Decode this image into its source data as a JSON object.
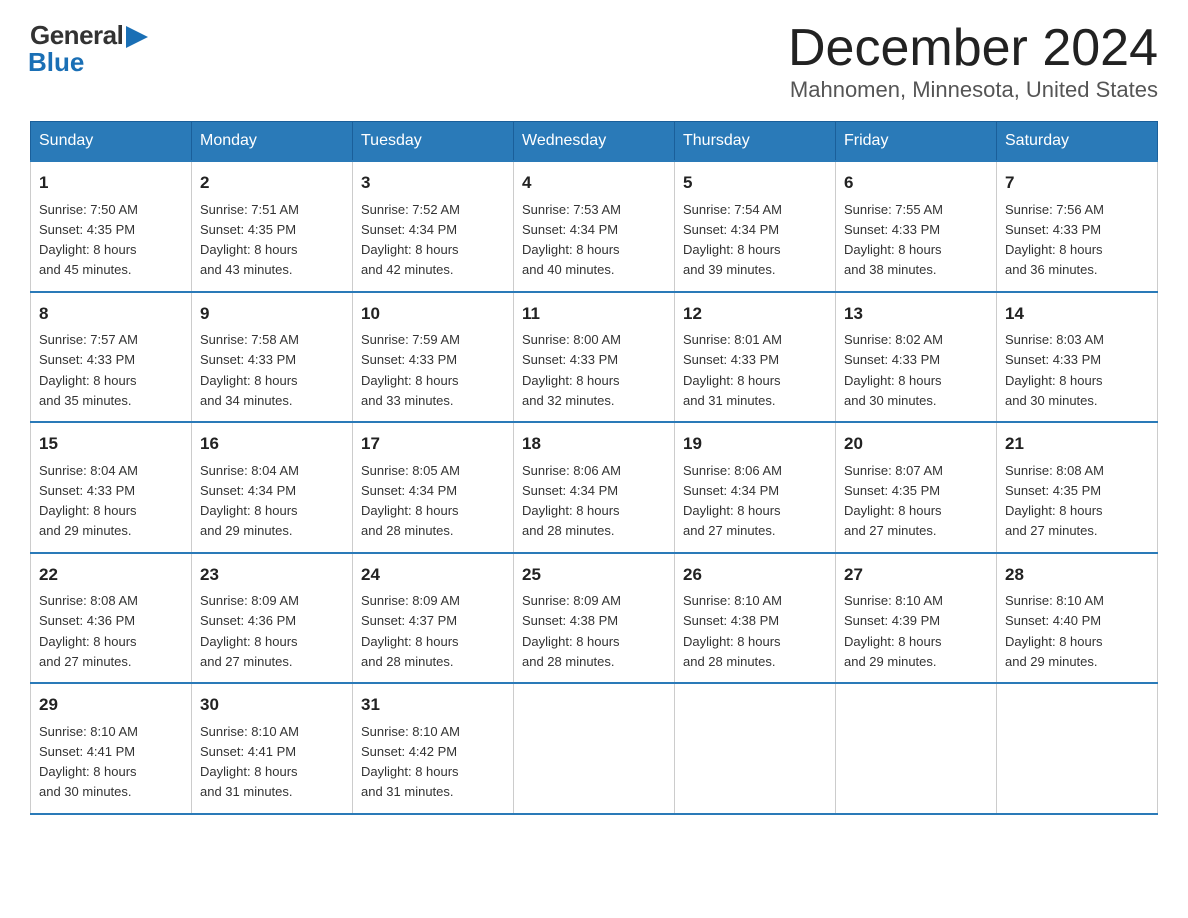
{
  "header": {
    "logo_general": "General",
    "logo_blue": "Blue",
    "month_title": "December 2024",
    "location": "Mahnomen, Minnesota, United States"
  },
  "days_of_week": [
    "Sunday",
    "Monday",
    "Tuesday",
    "Wednesday",
    "Thursday",
    "Friday",
    "Saturday"
  ],
  "weeks": [
    [
      {
        "day": "1",
        "sunrise": "7:50 AM",
        "sunset": "4:35 PM",
        "daylight": "8 hours and 45 minutes."
      },
      {
        "day": "2",
        "sunrise": "7:51 AM",
        "sunset": "4:35 PM",
        "daylight": "8 hours and 43 minutes."
      },
      {
        "day": "3",
        "sunrise": "7:52 AM",
        "sunset": "4:34 PM",
        "daylight": "8 hours and 42 minutes."
      },
      {
        "day": "4",
        "sunrise": "7:53 AM",
        "sunset": "4:34 PM",
        "daylight": "8 hours and 40 minutes."
      },
      {
        "day": "5",
        "sunrise": "7:54 AM",
        "sunset": "4:34 PM",
        "daylight": "8 hours and 39 minutes."
      },
      {
        "day": "6",
        "sunrise": "7:55 AM",
        "sunset": "4:33 PM",
        "daylight": "8 hours and 38 minutes."
      },
      {
        "day": "7",
        "sunrise": "7:56 AM",
        "sunset": "4:33 PM",
        "daylight": "8 hours and 36 minutes."
      }
    ],
    [
      {
        "day": "8",
        "sunrise": "7:57 AM",
        "sunset": "4:33 PM",
        "daylight": "8 hours and 35 minutes."
      },
      {
        "day": "9",
        "sunrise": "7:58 AM",
        "sunset": "4:33 PM",
        "daylight": "8 hours and 34 minutes."
      },
      {
        "day": "10",
        "sunrise": "7:59 AM",
        "sunset": "4:33 PM",
        "daylight": "8 hours and 33 minutes."
      },
      {
        "day": "11",
        "sunrise": "8:00 AM",
        "sunset": "4:33 PM",
        "daylight": "8 hours and 32 minutes."
      },
      {
        "day": "12",
        "sunrise": "8:01 AM",
        "sunset": "4:33 PM",
        "daylight": "8 hours and 31 minutes."
      },
      {
        "day": "13",
        "sunrise": "8:02 AM",
        "sunset": "4:33 PM",
        "daylight": "8 hours and 30 minutes."
      },
      {
        "day": "14",
        "sunrise": "8:03 AM",
        "sunset": "4:33 PM",
        "daylight": "8 hours and 30 minutes."
      }
    ],
    [
      {
        "day": "15",
        "sunrise": "8:04 AM",
        "sunset": "4:33 PM",
        "daylight": "8 hours and 29 minutes."
      },
      {
        "day": "16",
        "sunrise": "8:04 AM",
        "sunset": "4:34 PM",
        "daylight": "8 hours and 29 minutes."
      },
      {
        "day": "17",
        "sunrise": "8:05 AM",
        "sunset": "4:34 PM",
        "daylight": "8 hours and 28 minutes."
      },
      {
        "day": "18",
        "sunrise": "8:06 AM",
        "sunset": "4:34 PM",
        "daylight": "8 hours and 28 minutes."
      },
      {
        "day": "19",
        "sunrise": "8:06 AM",
        "sunset": "4:34 PM",
        "daylight": "8 hours and 27 minutes."
      },
      {
        "day": "20",
        "sunrise": "8:07 AM",
        "sunset": "4:35 PM",
        "daylight": "8 hours and 27 minutes."
      },
      {
        "day": "21",
        "sunrise": "8:08 AM",
        "sunset": "4:35 PM",
        "daylight": "8 hours and 27 minutes."
      }
    ],
    [
      {
        "day": "22",
        "sunrise": "8:08 AM",
        "sunset": "4:36 PM",
        "daylight": "8 hours and 27 minutes."
      },
      {
        "day": "23",
        "sunrise": "8:09 AM",
        "sunset": "4:36 PM",
        "daylight": "8 hours and 27 minutes."
      },
      {
        "day": "24",
        "sunrise": "8:09 AM",
        "sunset": "4:37 PM",
        "daylight": "8 hours and 28 minutes."
      },
      {
        "day": "25",
        "sunrise": "8:09 AM",
        "sunset": "4:38 PM",
        "daylight": "8 hours and 28 minutes."
      },
      {
        "day": "26",
        "sunrise": "8:10 AM",
        "sunset": "4:38 PM",
        "daylight": "8 hours and 28 minutes."
      },
      {
        "day": "27",
        "sunrise": "8:10 AM",
        "sunset": "4:39 PM",
        "daylight": "8 hours and 29 minutes."
      },
      {
        "day": "28",
        "sunrise": "8:10 AM",
        "sunset": "4:40 PM",
        "daylight": "8 hours and 29 minutes."
      }
    ],
    [
      {
        "day": "29",
        "sunrise": "8:10 AM",
        "sunset": "4:41 PM",
        "daylight": "8 hours and 30 minutes."
      },
      {
        "day": "30",
        "sunrise": "8:10 AM",
        "sunset": "4:41 PM",
        "daylight": "8 hours and 31 minutes."
      },
      {
        "day": "31",
        "sunrise": "8:10 AM",
        "sunset": "4:42 PM",
        "daylight": "8 hours and 31 minutes."
      },
      null,
      null,
      null,
      null
    ]
  ],
  "labels": {
    "sunrise": "Sunrise: ",
    "sunset": "Sunset: ",
    "daylight": "Daylight: "
  }
}
